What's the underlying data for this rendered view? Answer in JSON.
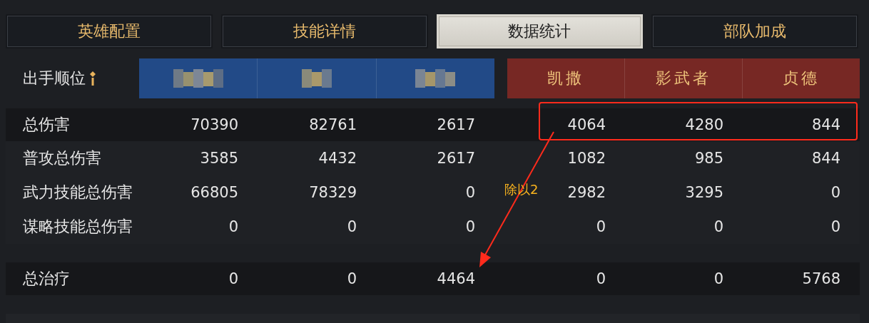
{
  "tabs": [
    {
      "label": "英雄配置",
      "selected": false
    },
    {
      "label": "技能详情",
      "selected": false
    },
    {
      "label": "数据统计",
      "selected": true
    },
    {
      "label": "部队加成",
      "selected": false
    }
  ],
  "table": {
    "order_label": "出手顺位",
    "teams": [
      {
        "color": "#224a87",
        "heroes": [
          {
            "kind": "redacted"
          },
          {
            "kind": "redacted"
          },
          {
            "kind": "redacted"
          }
        ]
      },
      {
        "color": "#772824",
        "heroes": [
          {
            "kind": "name",
            "name": "凯撒"
          },
          {
            "kind": "name",
            "name": "影武者"
          },
          {
            "kind": "name",
            "name": "贞德"
          }
        ]
      }
    ],
    "groups": [
      {
        "rows": [
          {
            "label": "总伤害",
            "values": [
              "70390",
              "82761",
              "2617",
              "4064",
              "4280",
              "844"
            ]
          },
          {
            "label": "普攻总伤害",
            "values": [
              "3585",
              "4432",
              "2617",
              "1082",
              "985",
              "844"
            ]
          },
          {
            "label": "武力技能总伤害",
            "values": [
              "66805",
              "78329",
              "0",
              "2982",
              "3295",
              "0"
            ]
          },
          {
            "label": "谋略技能总伤害",
            "values": [
              "0",
              "0",
              "0",
              "0",
              "0",
              "0"
            ]
          }
        ]
      },
      {
        "rows": [
          {
            "label": "总治疗",
            "values": [
              "0",
              "0",
              "4464",
              "0",
              "0",
              "5768"
            ]
          }
        ]
      }
    ]
  },
  "annotation": {
    "text": "除以2"
  }
}
